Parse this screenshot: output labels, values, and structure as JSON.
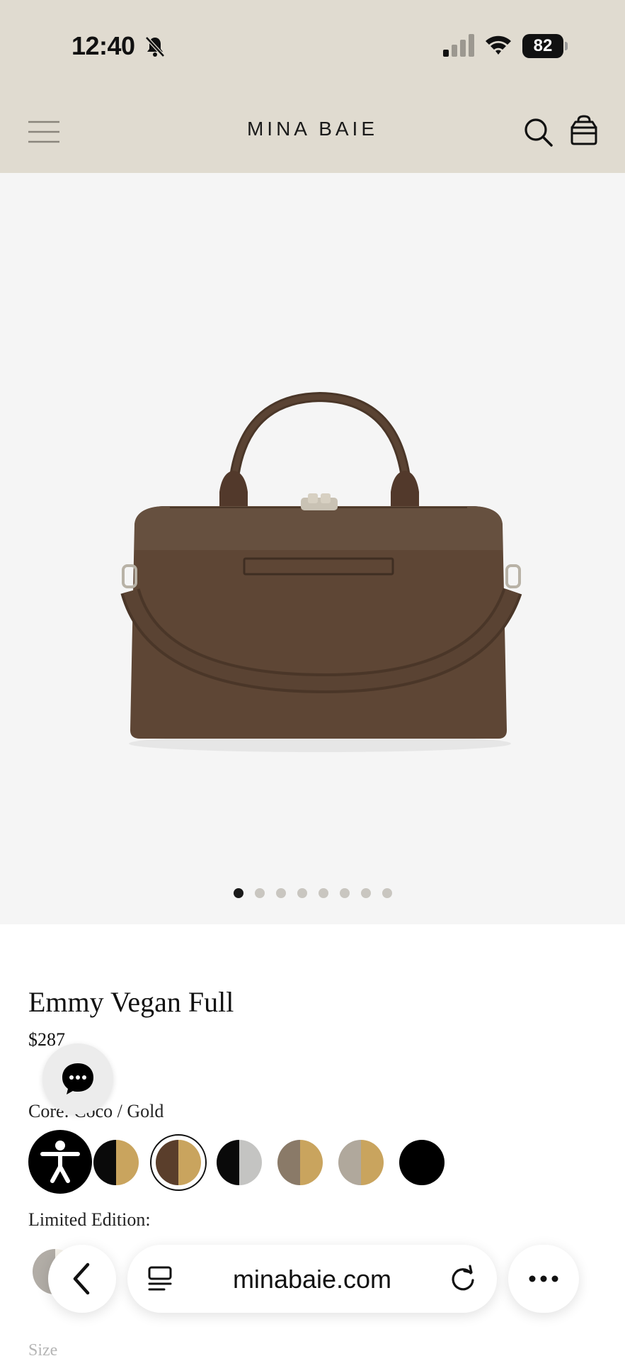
{
  "status_bar": {
    "time": "12:40",
    "battery": "82"
  },
  "header": {
    "brand": "MINA BAIE"
  },
  "gallery": {
    "image_count": 8,
    "active_index": 0
  },
  "product": {
    "title": "Emmy Vegan Full",
    "price": "$287",
    "color_label": "Core: Coco / Gold",
    "limited_label": "Limited Edition:",
    "size_label": "Size"
  },
  "swatches": [
    {
      "left": "#0a0a0a",
      "right": "#c9a45e",
      "selected": false
    },
    {
      "left": "#5a3e2b",
      "right": "#c9a45e",
      "selected": true
    },
    {
      "left": "#0a0a0a",
      "right": "#c4c4c2",
      "selected": false
    },
    {
      "left": "#8a7a68",
      "right": "#c9a45e",
      "selected": false
    },
    {
      "left": "#b0a89c",
      "right": "#c9a45e",
      "selected": false
    },
    {
      "left": "#000000",
      "right": "#000000",
      "selected": false
    }
  ],
  "browser": {
    "url": "minabaie.com"
  },
  "colors": {
    "header_bg": "#e0dbd0",
    "gallery_bg": "#f5f5f5",
    "bag": "#5e4635"
  }
}
